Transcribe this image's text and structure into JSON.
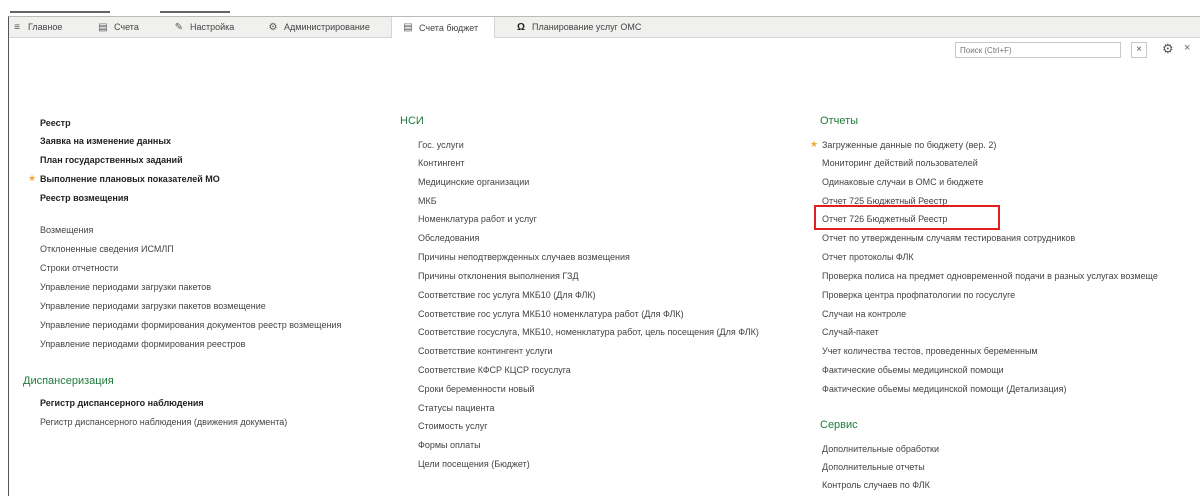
{
  "tabs": [
    {
      "label": "Главное",
      "icon": "menu-icon"
    },
    {
      "label": "Счета",
      "icon": "document-icon"
    },
    {
      "label": "Настройка",
      "icon": "wrench-icon"
    },
    {
      "label": "Администрирование",
      "icon": "gear-icon"
    },
    {
      "label": "Счета бюджет",
      "icon": "document-icon"
    },
    {
      "label": "Планирование услуг ОМС",
      "icon": "omega-icon"
    }
  ],
  "search": {
    "placeholder": "Поиск (Ctrl+F)"
  },
  "left": {
    "bold_items": [
      "Реестр",
      "Заявка на изменение данных",
      "План государственных заданий",
      "Выполнение плановых показателей МО",
      "Реестр возмещения"
    ],
    "items": [
      "Возмещения",
      "Отклоненные сведения ИСМЛП",
      "Строки отчетности",
      "Управление периодами загрузки пакетов",
      "Управление периодами загрузки пакетов возмещение",
      "Управление периодами формирования документов реестр возмещения",
      "Управление периодами формирования реестров"
    ],
    "section2_title": "Диспансеризация",
    "section2_bold": "Регистр диспансерного наблюдения",
    "section2_item": "Регистр диспансерного наблюдения (движения документа)"
  },
  "middle": {
    "title": "НСИ",
    "items": [
      "Гос. услуги",
      "Контингент",
      "Медицинские организации",
      "МКБ",
      "Номенклатура работ и услуг",
      "Обследования",
      "Причины неподтвержденных случаев возмещения",
      "Причины отклонения выполнения ГЗД",
      "Соответствие гос услуга МКБ10 (Для ФЛК)",
      "Соответствие гос услуга МКБ10 номенклатура работ (Для ФЛК)",
      "Соответствие госуслуга, МКБ10, номенклатура работ, цель посещения (Для ФЛК)",
      "Соответствие контингент услуги",
      "Соответствие КФСР КЦСР госуслуга",
      "Сроки беременности новый",
      "Статусы пациента",
      "Стоимость услуг",
      "Формы оплаты",
      "Цели посещения (Бюджет)"
    ]
  },
  "right": {
    "title": "Отчеты",
    "items": [
      "Загруженные данные по бюджету (вер. 2)",
      "Мониторинг действий пользователей",
      "Одинаковые случаи в ОМС и бюджете",
      "Отчет 725 Бюджетный Реестр",
      "Отчет 726 Бюджетный Реестр",
      "Отчет по утвержденным случаям тестирования сотрудников",
      "Отчет протоколы ФЛК",
      "Проверка полиса на предмет одновременной подачи в разных услугах возмеще",
      "Проверка центра профпатологии по госуслуге",
      "Случаи на контроле",
      "Случай-пакет",
      "Учет количества тестов, проведенных беременным",
      "Фактические обьемы медицинской помощи",
      "Фактические обьемы медицинской помощи (Детализация)"
    ],
    "service_title": "Сервис",
    "service_items": [
      "Дополнительные обработки",
      "Дополнительные отчеты",
      "Контроль случаев по ФЛК"
    ]
  },
  "colors": {
    "accent": "#1f7a3a",
    "highlight": "#e02020",
    "star": "#f2a93b"
  }
}
